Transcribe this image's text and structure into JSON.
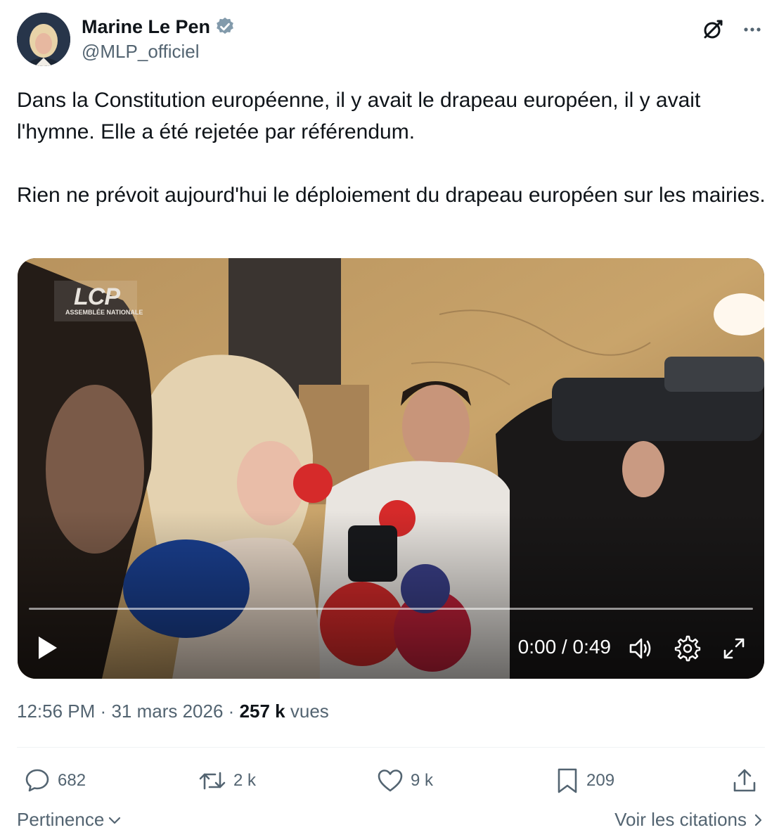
{
  "author": {
    "name": "Marine Le Pen",
    "handle": "@MLP_officiel",
    "verified": true
  },
  "header_icons": [
    "grok-icon",
    "more-icon"
  ],
  "tweet": {
    "paragraphs": [
      "Dans la Constitution européenne, il y avait le drapeau européen, il y avait l'hymne. Elle a été rejetée par référendum.",
      "Rien ne prévoit aujourd'hui le déploiement du drapeau européen sur les mairies."
    ]
  },
  "video": {
    "logo_text": "LCP",
    "logo_subtext": "ASSEMBLÉE NATIONALE",
    "current_time": "0:00",
    "duration": "0:49",
    "time_display": "0:00 / 0:49",
    "progress": 0
  },
  "meta": {
    "time": "12:56 PM",
    "separator": "·",
    "date": "31 mars 2026",
    "views_count": "257 k",
    "views_label": "vues"
  },
  "actions": {
    "replies": "682",
    "reposts": "2 k",
    "likes": "9 k",
    "bookmarks": "209"
  },
  "footer": {
    "sort_label": "Pertinence",
    "quotes_label": "Voir les citations"
  },
  "colors": {
    "text": "#0f1419",
    "secondary": "#536471",
    "accent": "#1d9bf0",
    "divider": "#eff3f4"
  }
}
